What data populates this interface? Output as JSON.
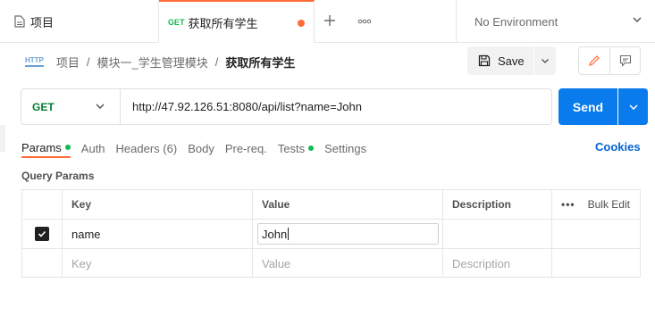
{
  "tabs": [
    {
      "label": "项目"
    },
    {
      "method": "GET",
      "label": "获取所有学生"
    }
  ],
  "environment": {
    "label": "No Environment"
  },
  "breadcrumb": {
    "root": "项目",
    "module": "模块一_学生管理模块",
    "current": "获取所有学生"
  },
  "toolbar": {
    "save_label": "Save"
  },
  "request": {
    "method": "GET",
    "url": "http://47.92.126.51:8080/api/list?name=John",
    "send_label": "Send"
  },
  "request_tabs": [
    {
      "label": "Params",
      "dot": true,
      "active": true
    },
    {
      "label": "Auth"
    },
    {
      "label": "Headers (6)"
    },
    {
      "label": "Body"
    },
    {
      "label": "Pre-req."
    },
    {
      "label": "Tests",
      "dot": true
    },
    {
      "label": "Settings"
    }
  ],
  "cookies_label": "Cookies",
  "query_params": {
    "title": "Query Params",
    "headers": {
      "key": "Key",
      "value": "Value",
      "description": "Description",
      "bulk": "Bulk Edit",
      "more": "•••"
    },
    "rows": [
      {
        "checked": true,
        "key": "name",
        "value": "John",
        "description": ""
      }
    ],
    "placeholders": {
      "key": "Key",
      "value": "Value",
      "description": "Description"
    }
  },
  "colors": {
    "accent": "#ff6c37",
    "send": "#097bed",
    "method_get": "#007f31",
    "dot": "#0cbb52"
  }
}
